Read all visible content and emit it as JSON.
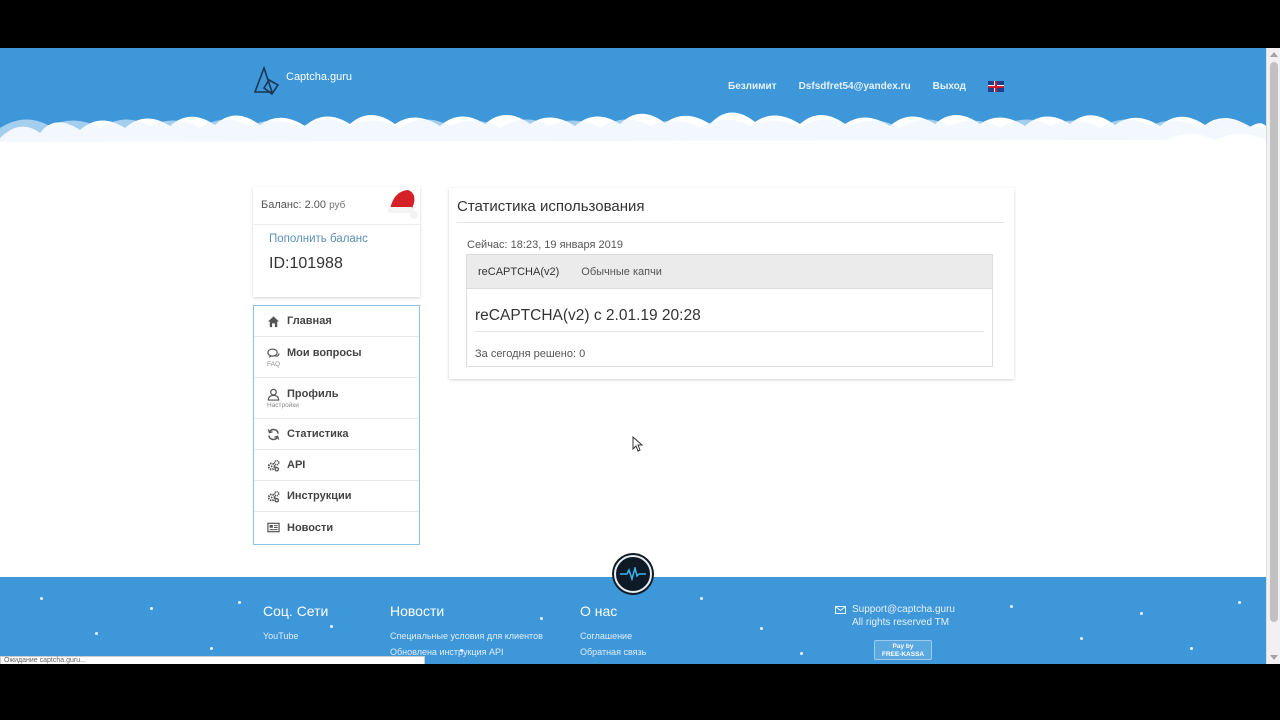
{
  "header": {
    "logo_text": "Captcha.guru",
    "nav": [
      "Безлимит",
      "Dsfsdfret54@yandex.ru",
      "Выход"
    ],
    "language_flag_icon": "uk-flag-icon"
  },
  "balance": {
    "label": "Баланс:",
    "amount": "2.00",
    "currency": "руб",
    "topup_label": "Пополнить баланс",
    "user_id": "ID:101988"
  },
  "menu": {
    "items": [
      {
        "label": "Главная",
        "sub": "",
        "icon": "home-icon"
      },
      {
        "label": "Мои вопросы",
        "sub": "FAQ",
        "icon": "chat-icon"
      },
      {
        "label": "Профиль",
        "sub": "Настройки",
        "icon": "user-icon"
      },
      {
        "label": "Статистика",
        "sub": "",
        "icon": "refresh-icon"
      },
      {
        "label": "API",
        "sub": "",
        "icon": "gears-icon"
      },
      {
        "label": "Инструкции",
        "sub": "",
        "icon": "gears-icon"
      },
      {
        "label": "Новости",
        "sub": "",
        "icon": "newspaper-icon"
      }
    ]
  },
  "stats": {
    "title": "Статистика использования",
    "now": "Сейчас: 18:23, 19 января 2019",
    "tabs": [
      "reCAPTCHA(v2)",
      "Обычные капчи"
    ],
    "heading": "reCAPTCHA(v2) с 2.01.19 20:28",
    "solved_today": "За сегодня решено: 0"
  },
  "footer": {
    "social": {
      "title": "Соц. Сети",
      "links": [
        "YouTube"
      ]
    },
    "news": {
      "title": "Новости",
      "links": [
        "Специальные условия для клиентов",
        "Обновлена инструкция API"
      ]
    },
    "about": {
      "title": "О нас",
      "links": [
        "Соглашение",
        "Обратная связь"
      ]
    },
    "email": "Support@captcha.guru",
    "rights": "All rights reserved TM",
    "payment_badge": [
      "Pay by",
      "FREE-KASSA"
    ]
  },
  "status_bar": "Ожидание captcha.guru...",
  "colors": {
    "header_blue": "#3d97d9",
    "menu_border": "#8cc3e6",
    "link": "#5b8fb9"
  }
}
